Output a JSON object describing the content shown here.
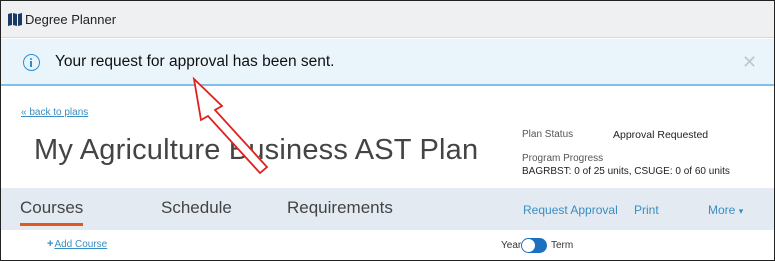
{
  "app": {
    "title": "Degree Planner",
    "icon": "book-map-icon"
  },
  "alert": {
    "message": "Your request for approval has been sent.",
    "close_glyph": "✕",
    "icon": "info-icon"
  },
  "header": {
    "back_link": "« back to plans",
    "plan_title": "My Agriculture Business AST Plan",
    "status_label": "Plan Status",
    "status_value": "Approval Requested",
    "progress_label": "Program Progress",
    "progress_value": "BAGRBST: 0 of 25 units, CSUGE: 0 of 60 units"
  },
  "tabs": [
    {
      "label": "Courses",
      "active": true
    },
    {
      "label": "Schedule",
      "active": false
    },
    {
      "label": "Requirements",
      "active": false
    }
  ],
  "actions": {
    "request_approval": "Request Approval",
    "print": "Print",
    "more": "More",
    "more_caret": "▾"
  },
  "toolbar": {
    "add_course_plus": "+",
    "add_course": "Add Course",
    "toggle_left": "Year",
    "toggle_right": "Term",
    "toggle_state": "Term"
  },
  "colors": {
    "accent": "#3a8ec2",
    "tab_underline": "#e0581c",
    "alert_bg": "#eaf4fb",
    "annotation_arrow": "#e0201c"
  }
}
